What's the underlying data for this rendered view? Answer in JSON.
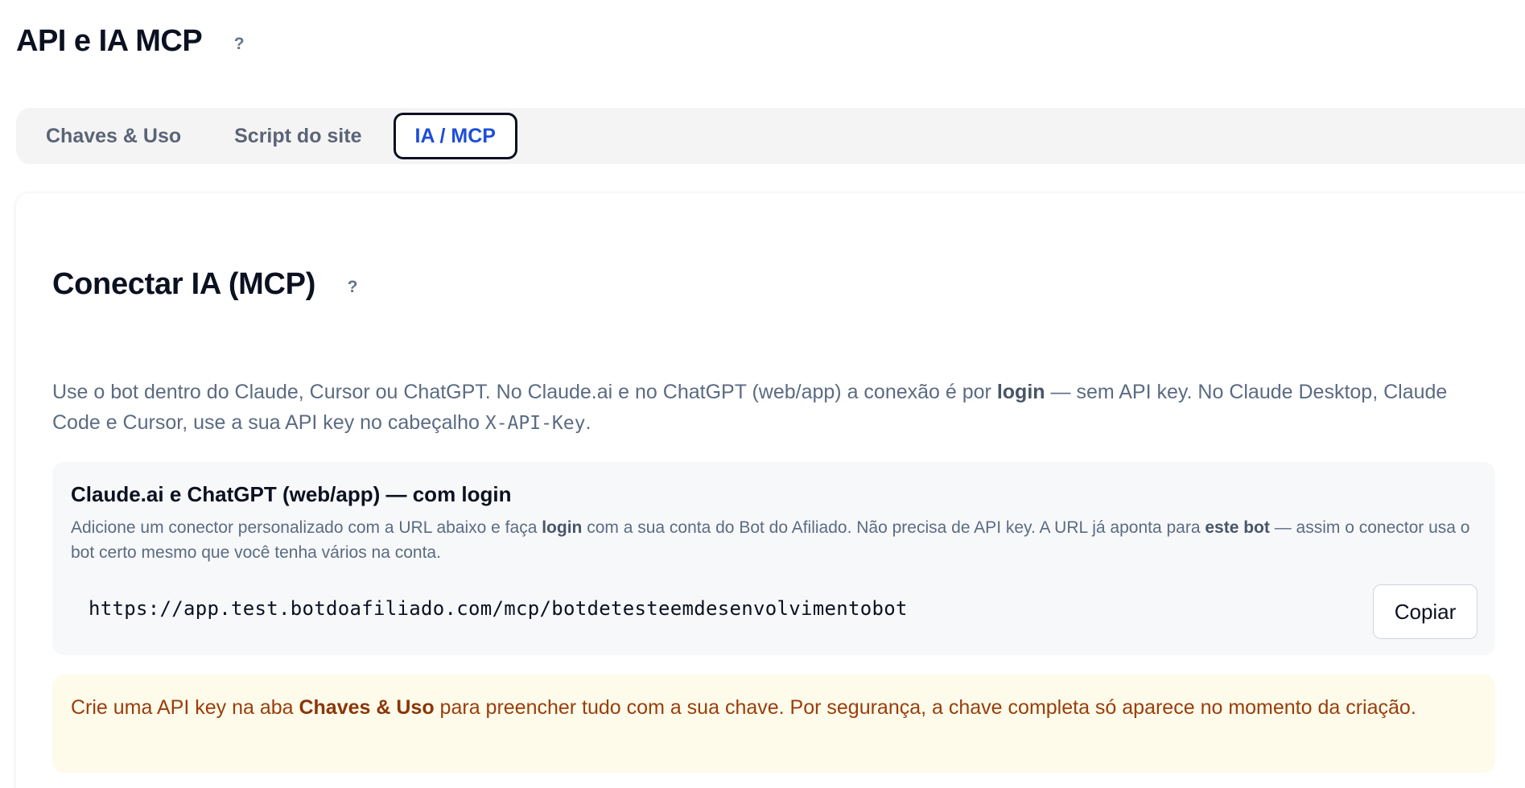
{
  "page": {
    "title": "API e IA MCP",
    "help": "?"
  },
  "tabs": [
    {
      "label": "Chaves & Uso",
      "active": false
    },
    {
      "label": "Script do site",
      "active": false
    },
    {
      "label": "IA / MCP",
      "active": true
    }
  ],
  "section": {
    "title": "Conectar IA (MCP)",
    "help": "?",
    "intro": {
      "part1": "Use o bot dentro do Claude, Cursor ou ChatGPT. No Claude.ai e no ChatGPT (web/app) a conexão é por ",
      "bold1": "login",
      "part2": " — sem API key. No Claude Desktop, Claude Code e Cursor, use a sua API key no cabeçalho ",
      "code": "X-API-Key",
      "part3": "."
    }
  },
  "login_box": {
    "title": "Claude.ai e ChatGPT (web/app) — com login",
    "desc_part1": "Adicione um conector personalizado com a URL abaixo e faça ",
    "desc_bold1": "login",
    "desc_part2": " com a sua conta do Bot do Afiliado. Não precisa de API key. A URL já aponta para ",
    "desc_bold2": "este bot",
    "desc_part3": " — assim o conector usa o bot certo mesmo que você tenha vários na conta.",
    "url": "https://app.test.botdoafiliado.com/mcp/botdetesteemdesenvolvimentobot",
    "copy_label": "Copiar"
  },
  "warning": {
    "part1": "Crie uma API key na aba ",
    "bold": "Chaves & Uso",
    "part2": " para preencher tudo com a sua chave. Por segurança, a chave completa só aparece no momento da criação."
  },
  "colors": {
    "active_tab_text": "#1d4ed8",
    "warning_bg": "#fefbea",
    "warning_text": "#9a3d0b"
  }
}
